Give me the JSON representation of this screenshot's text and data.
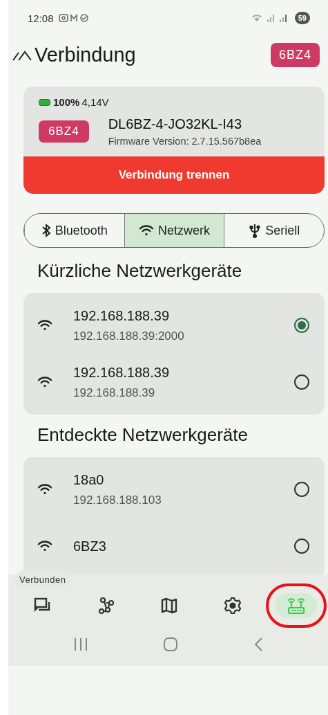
{
  "status_bar": {
    "time": "12:08",
    "battery": "59"
  },
  "header": {
    "title": "Verbindung",
    "badge": "6BZ4"
  },
  "device": {
    "battery_percent": "100%",
    "voltage": "4,14V",
    "badge": "6BZ4",
    "name": "DL6BZ-4-JO32KL-I43",
    "firmware": "Firmware Version: 2.7.15.567b8ea",
    "disconnect_button": "Verbindung trennen"
  },
  "tabs": [
    {
      "kind": "bluetooth",
      "label": "Bluetooth",
      "selected": false
    },
    {
      "kind": "wifi",
      "label": "Netzwerk",
      "selected": true
    },
    {
      "kind": "usb",
      "label": "Seriell",
      "selected": false
    }
  ],
  "sections": [
    {
      "title": "Kürzliche Netzwerkgeräte",
      "devices": [
        {
          "name": "192.168.188.39",
          "address": "192.168.188.39:2000",
          "selected": true
        },
        {
          "name": "192.168.188.39",
          "address": "192.168.188.39",
          "selected": false
        }
      ]
    },
    {
      "title": "Entdeckte Netzwerkgeräte",
      "devices": [
        {
          "name": "18a0",
          "address": "192.168.188.103",
          "selected": false
        },
        {
          "name": "6BZ3",
          "selected": false
        }
      ]
    }
  ],
  "toast": "Verbunden",
  "nav": [
    {
      "kind": "messages",
      "selected": false
    },
    {
      "kind": "nodes",
      "selected": false
    },
    {
      "kind": "map",
      "selected": false
    },
    {
      "kind": "settings",
      "selected": false
    },
    {
      "kind": "connection",
      "selected": true
    }
  ]
}
